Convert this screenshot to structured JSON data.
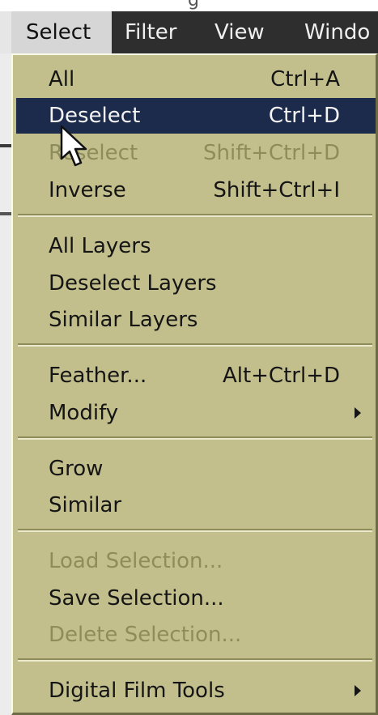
{
  "top_strip": {
    "partial_text": "g"
  },
  "menubar": {
    "items": [
      {
        "label": "Select",
        "active": true
      },
      {
        "label": "Filter"
      },
      {
        "label": "View"
      },
      {
        "label": "Windo"
      }
    ]
  },
  "select_menu": {
    "groups": [
      [
        {
          "label": "All",
          "shortcut": "Ctrl+A"
        },
        {
          "label": "Deselect",
          "shortcut": "Ctrl+D",
          "highlighted": true
        },
        {
          "label": "Reselect",
          "shortcut": "Shift+Ctrl+D",
          "disabled": true
        },
        {
          "label": "Inverse",
          "shortcut": "Shift+Ctrl+I"
        }
      ],
      [
        {
          "label": "All Layers"
        },
        {
          "label": "Deselect Layers"
        },
        {
          "label": "Similar Layers"
        }
      ],
      [
        {
          "label": "Feather...",
          "shortcut": "Alt+Ctrl+D"
        },
        {
          "label": "Modify",
          "submenu": true
        }
      ],
      [
        {
          "label": "Grow"
        },
        {
          "label": "Similar"
        }
      ],
      [
        {
          "label": "Load Selection...",
          "disabled": true
        },
        {
          "label": "Save Selection..."
        },
        {
          "label": "Delete Selection...",
          "disabled": true
        }
      ],
      [
        {
          "label": "Digital Film Tools",
          "submenu": true
        }
      ]
    ]
  },
  "colors": {
    "menu_background": "#c2bf8d",
    "highlight": "#1c2a4c",
    "disabled_text": "#8f8c5c",
    "menubar": "#2e2e2e"
  }
}
